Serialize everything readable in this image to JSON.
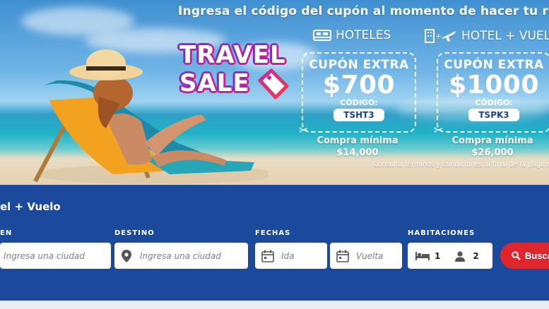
{
  "hero": {
    "headline": "Ingresa el código del cupón al momento de hacer tu reserva",
    "logo": {
      "line1": "TRAVEL",
      "line2": "SALE"
    },
    "categories": [
      {
        "label": "HOTELES",
        "icon": "bed-icon"
      },
      {
        "label": "HOTEL + VUELO",
        "icon": "hotel-plane-icon"
      }
    ],
    "coupons": [
      {
        "title": "CUPÓN EXTRA",
        "amount": "$700",
        "code_label": "CÓDIGO:",
        "code": "TSHT3",
        "min_label": "Compra mínima",
        "min_value": "$14,000"
      },
      {
        "title": "CUPÓN EXTRA",
        "amount": "$1000",
        "code_label": "CÓDIGO:",
        "code": "TSPK3",
        "min_label": "Compra mínima",
        "min_value": "$26,000"
      }
    ],
    "terms": "Consulta términos y condiciones al final de la página"
  },
  "search": {
    "title": "el + Vuelo",
    "origin_label": "EN",
    "origin_placeholder": "Ingresa una ciudad",
    "destination_label": "DESTINO",
    "destination_placeholder": "Ingresa una ciudad",
    "dates_label": "FECHAS",
    "depart_placeholder": "Ida",
    "return_placeholder": "Vuelta",
    "rooms_label": "HABITACIONES",
    "rooms_count": "1",
    "guests_count": "2",
    "search_button": "Busca"
  },
  "colors": {
    "panel_bg": "#1b4a9c",
    "search_button": "#e0262d",
    "code_text": "#1f3f8c"
  }
}
